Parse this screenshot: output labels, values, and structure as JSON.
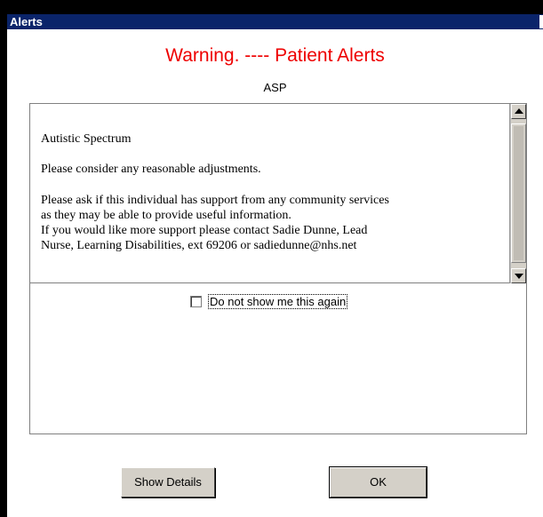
{
  "window": {
    "title": "Alerts"
  },
  "dialog": {
    "heading": "Warning. ----  Patient Alerts",
    "alert_code": "ASP",
    "alert_text": {
      "title": "Autistic Spectrum",
      "adjustments": "Please consider any reasonable adjustments.",
      "support_lines": [
        "Please ask if this individual has support from any community services",
        "as they may be able to provide useful information.",
        "If you would like more support please contact Sadie Dunne, Lead",
        "Nurse, Learning Disabilities, ext 69206 or sadiedunne@nhs.net"
      ]
    },
    "checkbox": {
      "label": "Do not show me this again",
      "checked": false
    },
    "buttons": {
      "show_details": "Show Details",
      "ok": "OK"
    }
  },
  "icons": {
    "scroll_up": "scroll-up-arrow-icon",
    "scroll_down": "scroll-down-arrow-icon"
  },
  "colors": {
    "title_bar": "#0a246a",
    "heading": "#ee0000",
    "button_face": "#d4d0c8"
  }
}
